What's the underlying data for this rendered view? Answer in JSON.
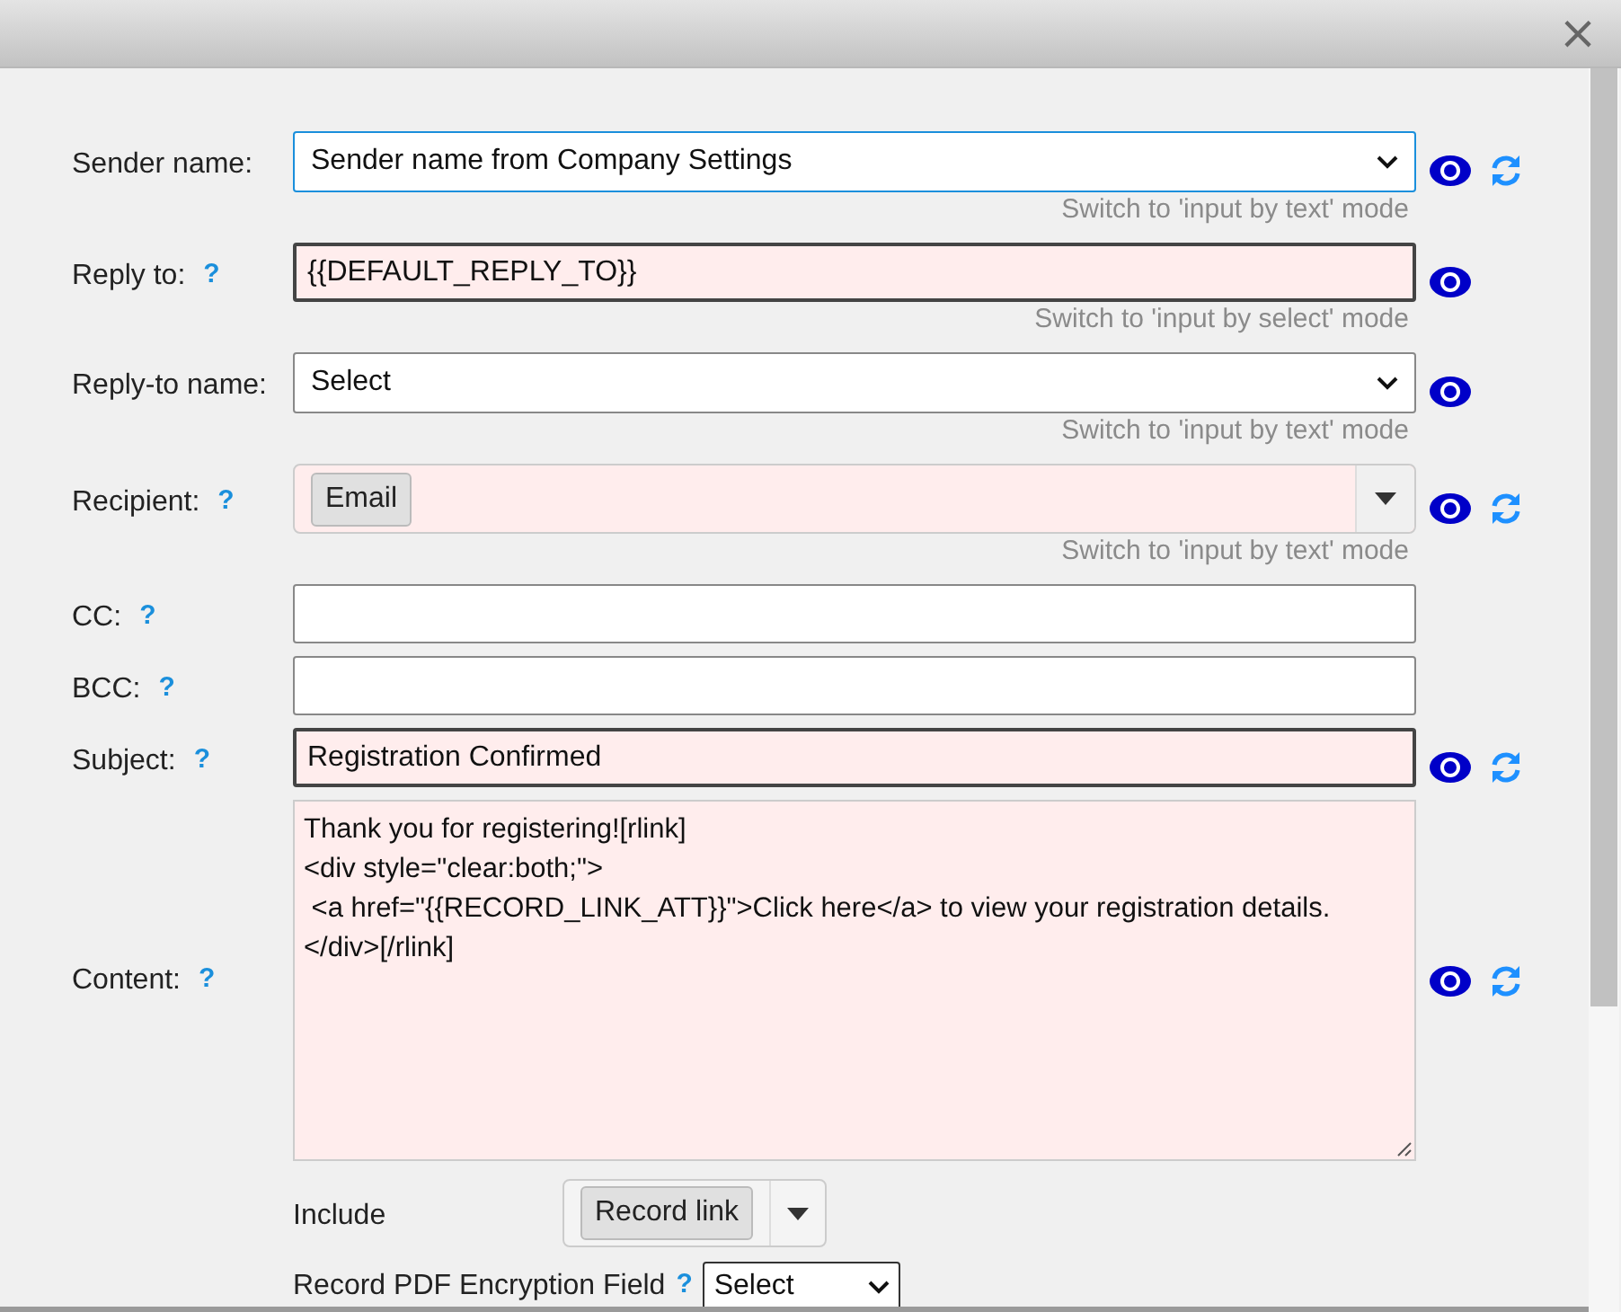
{
  "dialog": {
    "close": "×"
  },
  "fields": [
    {
      "label": "Sender name:",
      "kind": "select",
      "value": "Sender name from Company Settings",
      "highlighted": false,
      "focused": true,
      "emphasized": false,
      "preview": true,
      "refresh": true,
      "hint": "Switch to 'input by text' mode"
    },
    {
      "label": "Reply to:",
      "help": "?",
      "kind": "text",
      "value": "{{DEFAULT_REPLY_TO}}",
      "highlighted": true,
      "focused": false,
      "emphasized": true,
      "preview": true,
      "refresh": false,
      "hint": "Switch to 'input by select' mode"
    },
    {
      "label": "Reply-to name:",
      "kind": "select",
      "value": "Select",
      "highlighted": false,
      "focused": false,
      "emphasized": false,
      "preview": true,
      "refresh": false,
      "hint": "Switch to 'input by text' mode"
    },
    {
      "label": "Recipient:",
      "help": "?",
      "kind": "tags",
      "tags": [
        "Email"
      ],
      "highlighted": true,
      "focused": false,
      "emphasized": false,
      "preview": true,
      "refresh": true,
      "hint": "Switch to 'input by text' mode"
    },
    {
      "label": "CC:",
      "help": "?",
      "kind": "text",
      "highlighted": false,
      "focused": false,
      "emphasized": false,
      "preview": false,
      "refresh": false
    },
    {
      "label": "BCC:",
      "help": "?",
      "kind": "text",
      "highlighted": false,
      "focused": false,
      "emphasized": false,
      "preview": false,
      "refresh": false
    },
    {
      "label": "Subject:",
      "help": "?",
      "kind": "text",
      "value": "Registration Confirmed",
      "highlighted": true,
      "focused": false,
      "emphasized": true,
      "preview": true,
      "refresh": true
    },
    {
      "label": "Content:",
      "help": "?",
      "kind": "textarea",
      "value": "Thank you for registering![rlink]\n<div style=\"clear:both;\">\n <a href=\"{{RECORD_LINK_ATT}}\">Click here</a> to view your registration details.\n</div>[/rlink]",
      "highlighted": true,
      "focused": false,
      "emphasized": false,
      "preview": true,
      "refresh": true
    }
  ],
  "include": {
    "label": "Include",
    "tags": [
      "Record link"
    ]
  },
  "pdf_encryption": {
    "label": "Record PDF Encryption Field",
    "help": "?",
    "value": "Select"
  }
}
